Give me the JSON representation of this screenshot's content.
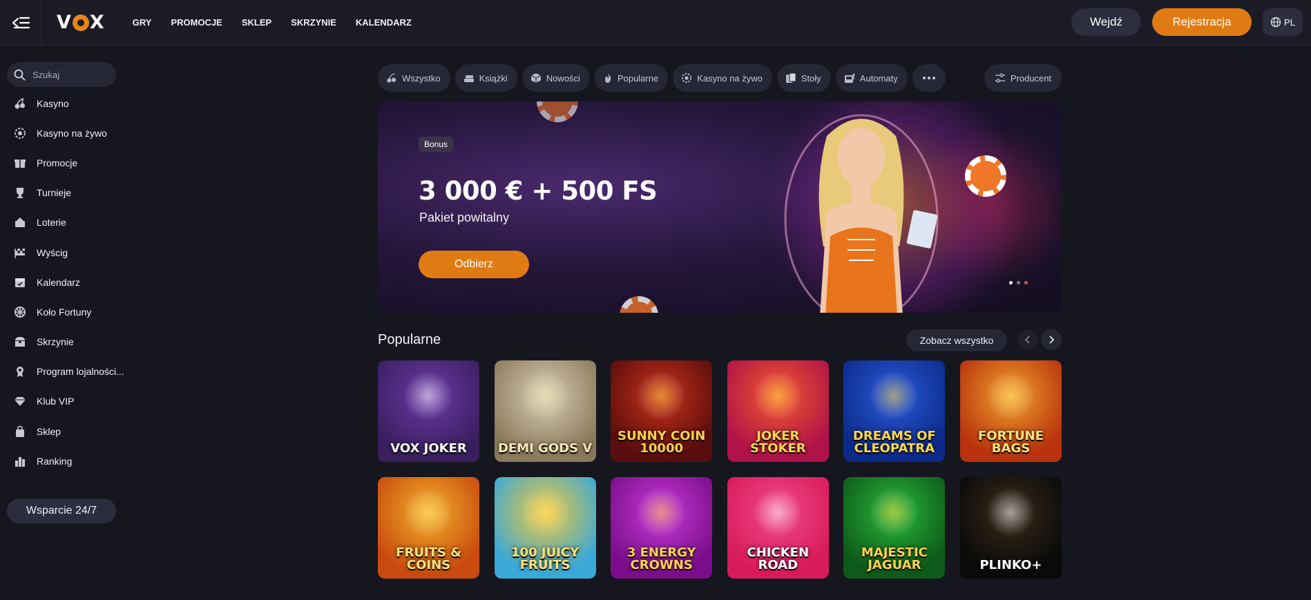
{
  "header": {
    "logo": "VOX",
    "nav": [
      "GRY",
      "PROMOCJE",
      "SKLEP",
      "SKRZYNIE",
      "KALENDARZ"
    ],
    "login_label": "Wejdź",
    "register_label": "Rejestracja",
    "lang": "PL"
  },
  "sidebar": {
    "search_placeholder": "Szukaj",
    "items": [
      {
        "label": "Kasyno",
        "icon": "cherries-icon"
      },
      {
        "label": "Kasyno na żywo",
        "icon": "live-chip-icon"
      },
      {
        "label": "Promocje",
        "icon": "gift-icon"
      },
      {
        "label": "Turnieje",
        "icon": "trophy-icon"
      },
      {
        "label": "Loterie",
        "icon": "lottery-icon"
      },
      {
        "label": "Wyścig",
        "icon": "race-flag-icon"
      },
      {
        "label": "Kalendarz",
        "icon": "calendar-icon"
      },
      {
        "label": "Koło Fortuny",
        "icon": "wheel-icon"
      },
      {
        "label": "Skrzynie",
        "icon": "chest-icon"
      },
      {
        "label": "Program lojalności...",
        "icon": "loyalty-badge-icon"
      },
      {
        "label": "Klub VIP",
        "icon": "diamond-icon"
      },
      {
        "label": "Sklep",
        "icon": "shopping-bag-icon"
      },
      {
        "label": "Ranking",
        "icon": "ranking-bars-icon"
      }
    ],
    "support_label": "Wsparcie 24/7"
  },
  "filters": {
    "chips": [
      {
        "label": "Wszystko",
        "icon": "cherries-icon"
      },
      {
        "label": "Książki",
        "icon": "books-icon"
      },
      {
        "label": "Nowości",
        "icon": "cube-icon"
      },
      {
        "label": "Popularne",
        "icon": "fire-icon"
      },
      {
        "label": "Kasyno na żywo",
        "icon": "live-chip-icon"
      },
      {
        "label": "Stoły",
        "icon": "cards-icon"
      },
      {
        "label": "Automaty",
        "icon": "slot-machine-icon"
      }
    ],
    "producer_label": "Producent"
  },
  "banner": {
    "badge": "Bonus",
    "title": "3 000 € + 500 FS",
    "subtitle": "Pakiet powitalny",
    "cta": "Odbierz",
    "slides": 3,
    "active_slide": 1
  },
  "popular": {
    "title": "Popularne",
    "see_all": "Zobacz wszystko",
    "games": [
      {
        "name": "VOX JOKER",
        "bg": "#3a1f5e",
        "bg2": "#6b3aa8",
        "text": "#ffffff"
      },
      {
        "name": "DEMI GODS V",
        "bg": "#8b7a5c",
        "bg2": "#d8ccb0",
        "text": "#f5e6b8"
      },
      {
        "name": "SUNNY COIN 10000",
        "bg": "#5a0d0d",
        "bg2": "#c8321a",
        "text": "#ffd24a"
      },
      {
        "name": "JOKER STOKER",
        "bg": "#b0124a",
        "bg2": "#f25a2a",
        "text": "#ffd84a"
      },
      {
        "name": "DREAMS OF CLEOPATRA",
        "bg": "#0c2a8a",
        "bg2": "#2a5ad8",
        "text": "#ffd84a"
      },
      {
        "name": "FORTUNE BAGS",
        "bg": "#b8320e",
        "bg2": "#f0a02a",
        "text": "#ffe27a"
      },
      {
        "name": "FRUITS & COINS",
        "bg": "#c84a0e",
        "bg2": "#f2b02a",
        "text": "#ffe27a"
      },
      {
        "name": "100 JUICY FRUITS",
        "bg": "#3aa8d8",
        "bg2": "#f0c83a",
        "text": "#ffe27a"
      },
      {
        "name": "3 ENERGY CROWNS",
        "bg": "#7a0e8a",
        "bg2": "#c83ad8",
        "text": "#ffd24a"
      },
      {
        "name": "CHICKEN ROAD",
        "bg": "#d81a5a",
        "bg2": "#f04a8a",
        "text": "#ffffff"
      },
      {
        "name": "MAJESTIC JAGUAR",
        "bg": "#0e5a1a",
        "bg2": "#2ab83a",
        "text": "#ffd24a"
      },
      {
        "name": "PLINKO+",
        "bg": "#0a0a0a",
        "bg2": "#3a2a1a",
        "text": "#ffffff"
      }
    ]
  },
  "colors": {
    "accent": "#e07b14",
    "background": "#16161f",
    "surface": "#262735"
  }
}
